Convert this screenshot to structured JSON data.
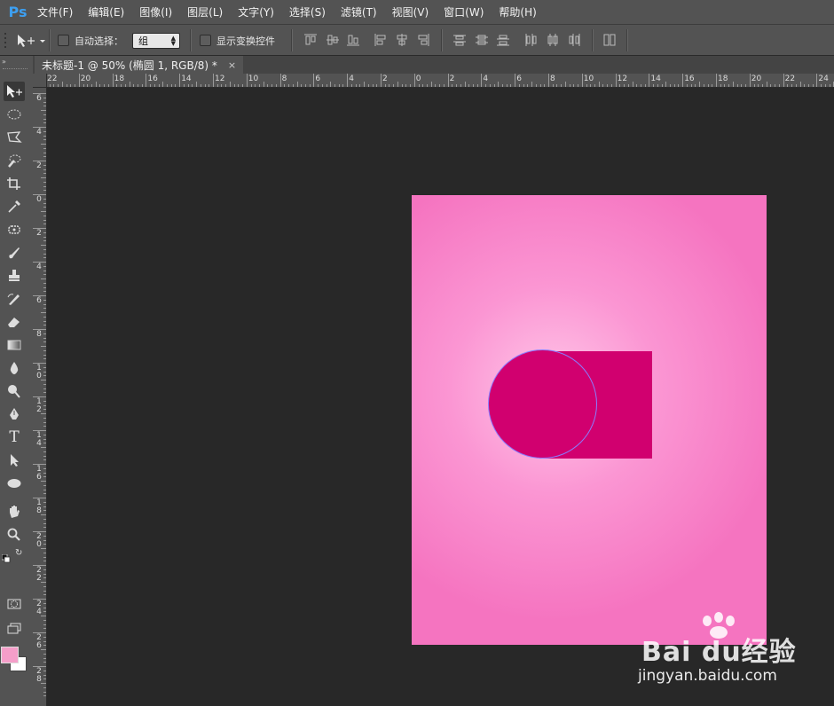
{
  "app": {
    "logo": "Ps"
  },
  "menu": [
    {
      "label": "文件(F)"
    },
    {
      "label": "编辑(E)"
    },
    {
      "label": "图像(I)"
    },
    {
      "label": "图层(L)"
    },
    {
      "label": "文字(Y)"
    },
    {
      "label": "选择(S)"
    },
    {
      "label": "滤镜(T)"
    },
    {
      "label": "视图(V)"
    },
    {
      "label": "窗口(W)"
    },
    {
      "label": "帮助(H)"
    }
  ],
  "options": {
    "auto_select_label": "自动选择：",
    "auto_select_value": "组",
    "show_transform_label": "显示变换控件"
  },
  "document": {
    "tab_title": "未标题-1 @ 50% (椭圆 1, RGB/8) *",
    "close_glyph": "×"
  },
  "ruler": {
    "top_labels": [
      "22",
      "20",
      "18",
      "16",
      "14",
      "12",
      "10",
      "8",
      "6",
      "4",
      "2",
      "0",
      "2",
      "4",
      "6",
      "8",
      "10",
      "12",
      "14",
      "16",
      "18",
      "20",
      "22",
      "24"
    ],
    "left_labels": [
      "6",
      "4",
      "2",
      "0",
      "2",
      "4",
      "6",
      "8",
      "10",
      "12",
      "14",
      "16",
      "18",
      "20",
      "22",
      "24",
      "26",
      "28"
    ]
  },
  "colors": {
    "foreground": "#f59ec9",
    "background": "#ffffff",
    "shape_fill": "#d1006f",
    "canvas_pink": "#f574c0",
    "ps_blue": "#3d9ff0"
  },
  "tools": [
    "move-tool-icon",
    "marquee-ellipse-icon",
    "lasso-polygon-icon",
    "quick-selection-icon",
    "crop-icon",
    "eyedropper-icon",
    "spot-healing-icon",
    "brush-icon",
    "clone-stamp-icon",
    "history-brush-icon",
    "eraser-icon",
    "gradient-icon",
    "blur-icon",
    "dodge-icon",
    "pen-icon",
    "type-icon",
    "path-selection-icon",
    "ellipse-shape-icon",
    "hand-icon",
    "zoom-icon"
  ],
  "watermark": {
    "brand": "Bai du经验",
    "url": "jingyan.baidu.com"
  }
}
